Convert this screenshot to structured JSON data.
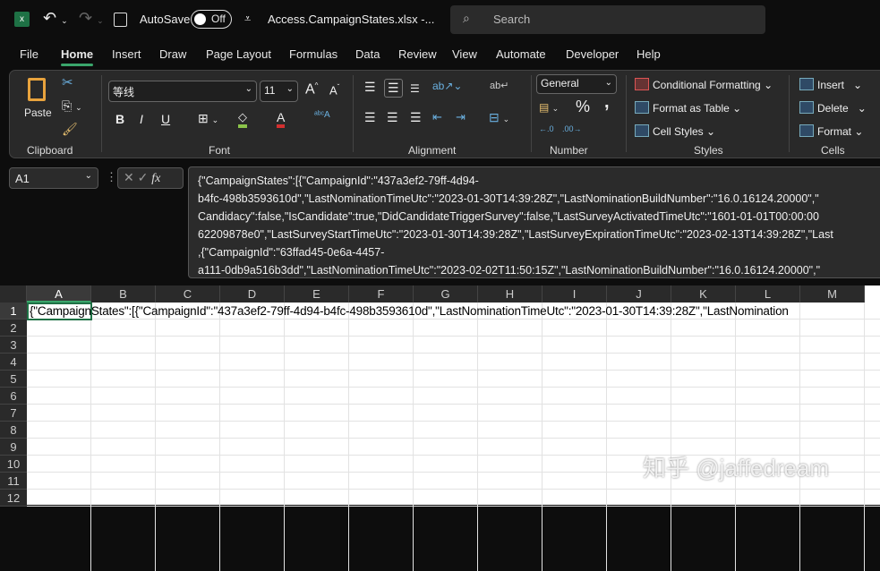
{
  "titlebar": {
    "autosave_label": "AutoSave",
    "autosave_state": "Off",
    "filename": "Access.CampaignStates.xlsx  -...",
    "search_placeholder": "Search"
  },
  "tabs": [
    "File",
    "Home",
    "Insert",
    "Draw",
    "Page Layout",
    "Formulas",
    "Data",
    "Review",
    "View",
    "Automate",
    "Developer",
    "Help"
  ],
  "ribbon": {
    "clipboard": {
      "label": "Clipboard",
      "paste": "Paste"
    },
    "font": {
      "label": "Font",
      "font_name": "等线",
      "font_size": "11",
      "bold": "B",
      "italic": "I",
      "underline": "U"
    },
    "alignment": {
      "label": "Alignment"
    },
    "number": {
      "label": "Number",
      "format": "General",
      "percent": "%",
      "comma": ","
    },
    "styles": {
      "label": "Styles",
      "conditional": "Conditional Formatting",
      "format_table": "Format as Table",
      "cell_styles": "Cell Styles"
    },
    "cells": {
      "label": "Cells",
      "insert": "Insert",
      "delete": "Delete",
      "format": "Format"
    }
  },
  "formula_bar": {
    "name_box": "A1",
    "fx": "fx",
    "lines": [
      "{\"CampaignStates\":[{\"CampaignId\":\"437a3ef2-79ff-4d94-",
      "b4fc-498b3593610d\",\"LastNominationTimeUtc\":\"2023-01-30T14:39:28Z\",\"LastNominationBuildNumber\":\"16.0.16124.20000\",\"",
      "Candidacy\":false,\"IsCandidate\":true,\"DidCandidateTriggerSurvey\":false,\"LastSurveyActivatedTimeUtc\":\"1601-01-01T00:00:00",
      "62209878e0\",\"LastSurveyStartTimeUtc\":\"2023-01-30T14:39:28Z\",\"LastSurveyExpirationTimeUtc\":\"2023-02-13T14:39:28Z\",\"Last",
      ",{\"CampaignId\":\"63ffad45-0e6a-4457-",
      "a111-0db9a516b3dd\",\"LastNominationTimeUtc\":\"2023-02-02T11:50:15Z\",\"LastNominationBuildNumber\":\"16.0.16124.20000\",\""
    ]
  },
  "sheet": {
    "columns": [
      "A",
      "B",
      "C",
      "D",
      "E",
      "F",
      "G",
      "H",
      "I",
      "J",
      "K",
      "L",
      "M"
    ],
    "rows": [
      "1",
      "2",
      "3",
      "4",
      "5",
      "6",
      "7",
      "8",
      "9",
      "10",
      "11",
      "12"
    ],
    "a1_value": "{\"CampaignStates\":[{\"CampaignId\":\"437a3ef2-79ff-4d94-b4fc-498b3593610d\",\"LastNominationTimeUtc\":\"2023-01-30T14:39:28Z\",\"LastNomination"
  },
  "watermark": "知乎 @jaffedream"
}
